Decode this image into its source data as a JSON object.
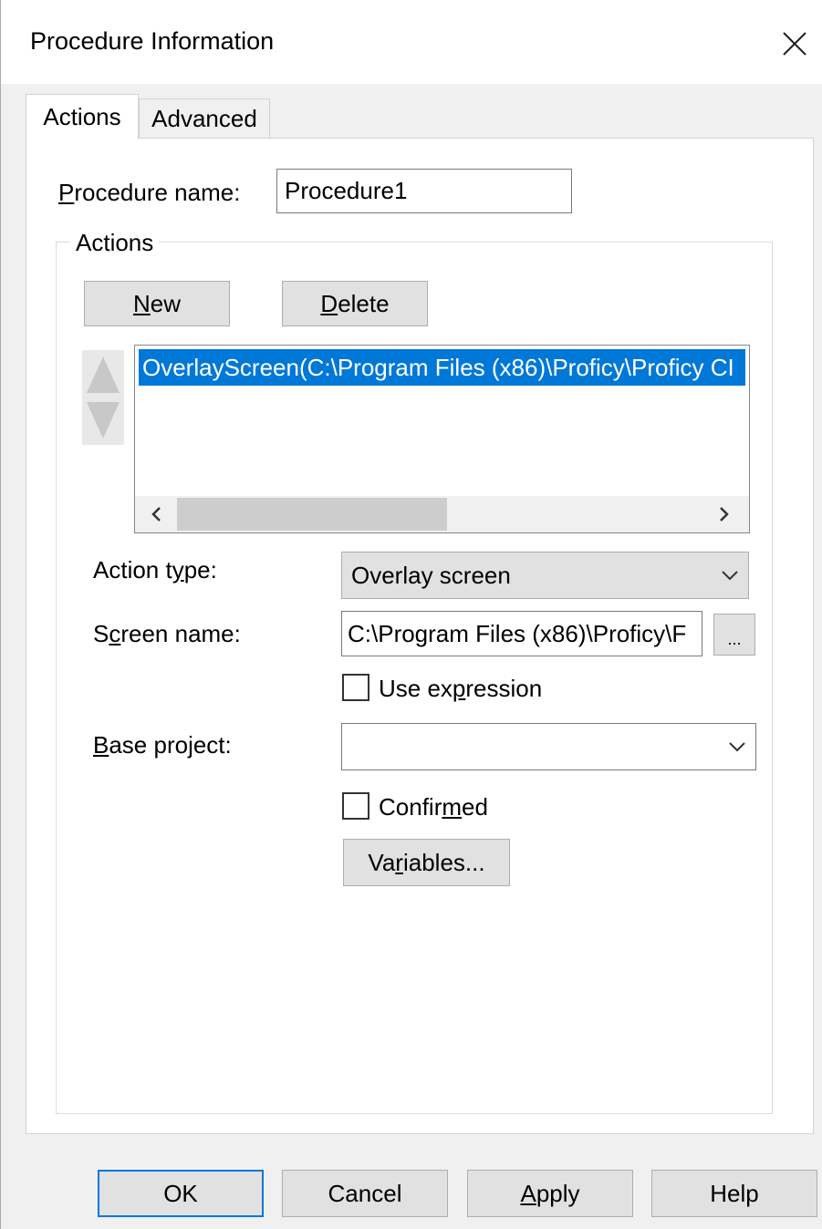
{
  "window": {
    "title": "Procedure Information",
    "close_glyph": "✕"
  },
  "tabs": [
    {
      "label": "Actions",
      "active": true
    },
    {
      "label": "Advanced",
      "active": false
    }
  ],
  "procedure_name": {
    "label_pre": "",
    "label_ul": "P",
    "label_post": "rocedure name:",
    "value": "Procedure1"
  },
  "actions_group": {
    "caption": "Actions",
    "new_btn": {
      "ul": "N",
      "rest": "ew"
    },
    "delete_btn": {
      "ul": "D",
      "rest": "elete"
    },
    "list_items": [
      "OverlayScreen(C:\\Program Files (x86)\\Proficy\\Proficy CI"
    ],
    "action_type": {
      "label_pre": "Action t",
      "label_ul": "y",
      "label_post": "pe:",
      "value": "Overlay screen"
    },
    "screen_name": {
      "label_pre": "S",
      "label_ul": "c",
      "label_post": "reen name:",
      "value": "C:\\Program Files (x86)\\Proficy\\F",
      "browse_label": "..."
    },
    "use_expression": {
      "pre": "Use ex",
      "ul": "p",
      "post": "ression",
      "checked": false
    },
    "base_project": {
      "label_pre": "",
      "label_ul": "B",
      "label_post": "ase project:",
      "value": ""
    },
    "confirmed": {
      "pre": "Confir",
      "ul": "m",
      "post": "ed",
      "checked": false
    },
    "variables_btn": {
      "pre": "Va",
      "ul": "r",
      "post": "iables..."
    }
  },
  "footer": {
    "ok": "OK",
    "cancel": "Cancel",
    "apply": {
      "ul": "A",
      "rest": "pply"
    },
    "help": "Help"
  },
  "colors": {
    "selection": "#0078d7",
    "default_button_border": "#0078d7"
  }
}
